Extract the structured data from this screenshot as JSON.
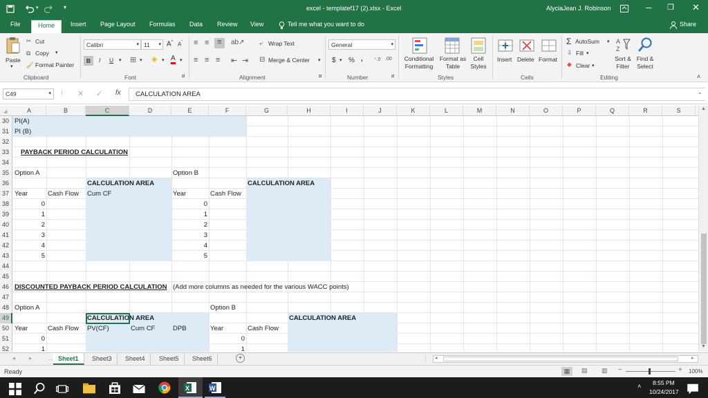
{
  "window": {
    "title": "excel - templatef17 (2).xlsx  -  Excel",
    "user": "AlyciaJean J. Robinson"
  },
  "ribbon_tabs": [
    "File",
    "Home",
    "Insert",
    "Page Layout",
    "Formulas",
    "Data",
    "Review",
    "View"
  ],
  "tell_me": "Tell me what you want to do",
  "share": "Share",
  "clipboard": {
    "paste": "Paste",
    "cut": "Cut",
    "copy": "Copy",
    "format_painter": "Format Painter",
    "label": "Clipboard"
  },
  "font": {
    "name": "Calibri",
    "size": "11",
    "bold": "B",
    "italic": "I",
    "underline": "U",
    "label": "Font"
  },
  "alignment": {
    "wrap": "Wrap Text",
    "merge": "Merge & Center",
    "label": "Alignment"
  },
  "number": {
    "format": "General",
    "currency": "$",
    "percent": "%",
    "comma": ",",
    "label": "Number"
  },
  "styles": {
    "conditional": "Conditional Formatting",
    "format_table": "Format as Table",
    "cell_styles": "Cell Styles",
    "label": "Styles"
  },
  "cells": {
    "insert": "Insert",
    "delete": "Delete",
    "format": "Format",
    "label": "Cells"
  },
  "editing": {
    "autosum": "AutoSum",
    "fill": "Fill",
    "clear": "Clear",
    "sort": "Sort & Filter",
    "find": "Find & Select",
    "label": "Editing"
  },
  "formula_bar": {
    "name_box": "C49",
    "fx": "fx",
    "content": "CALCULATION AREA"
  },
  "columns": [
    "A",
    "B",
    "C",
    "D",
    "E",
    "F",
    "G",
    "H",
    "I",
    "J",
    "K",
    "L",
    "M",
    "N",
    "O",
    "P",
    "Q",
    "R",
    "S"
  ],
  "rows": [
    "30",
    "31",
    "32",
    "33",
    "34",
    "35",
    "36",
    "37",
    "38",
    "39",
    "40",
    "41",
    "42",
    "43",
    "44",
    "45",
    "46",
    "47",
    "48",
    "49",
    "50",
    "51",
    "52"
  ],
  "cells_data": {
    "r30a": "PI(A)",
    "r31a": "PI (B)",
    "r33a": "PAYBACK PERIOD CALCULATION",
    "r35a": "Option A",
    "r35e": "Option B",
    "r36c": "CALCULATION AREA",
    "r36g": "CALCULATION AREA",
    "r37a": "Year",
    "r37b": "Cash Flow",
    "r37c": "Cum CF",
    "r37e": "Year",
    "r37f": "Cash Flow",
    "years": [
      "0",
      "1",
      "2",
      "3",
      "4",
      "5"
    ],
    "r46a": "DISCOUNTED PAYBACK PERIOD CALCULATION",
    "r46e": "(Add more columns as needed for the various WACC points)",
    "r48a": "Option A",
    "r48f": "Option B",
    "r49c": "CALCULATION AREA",
    "r49h": "CALCULATION AREA",
    "r50a": "Year",
    "r50b": "Cash Flow",
    "r50c": "PV(CF)",
    "r50d": "Cum CF",
    "r50e": "DPB",
    "r50f": "Year",
    "r50g": "Cash Flow",
    "r51a": "0",
    "r51f": "0",
    "r52a": "1",
    "r52f": "1"
  },
  "sheet_tabs": [
    "Sheet1",
    "Sheet3",
    "Sheet4",
    "Sheet5",
    "Sheet6"
  ],
  "status": {
    "ready": "Ready",
    "zoom": "100%"
  },
  "taskbar": {
    "time": "8:55 PM",
    "date": "10/24/2017"
  },
  "colors": {
    "excel_green": "#217346",
    "calc_fill": "#ddebf7"
  }
}
